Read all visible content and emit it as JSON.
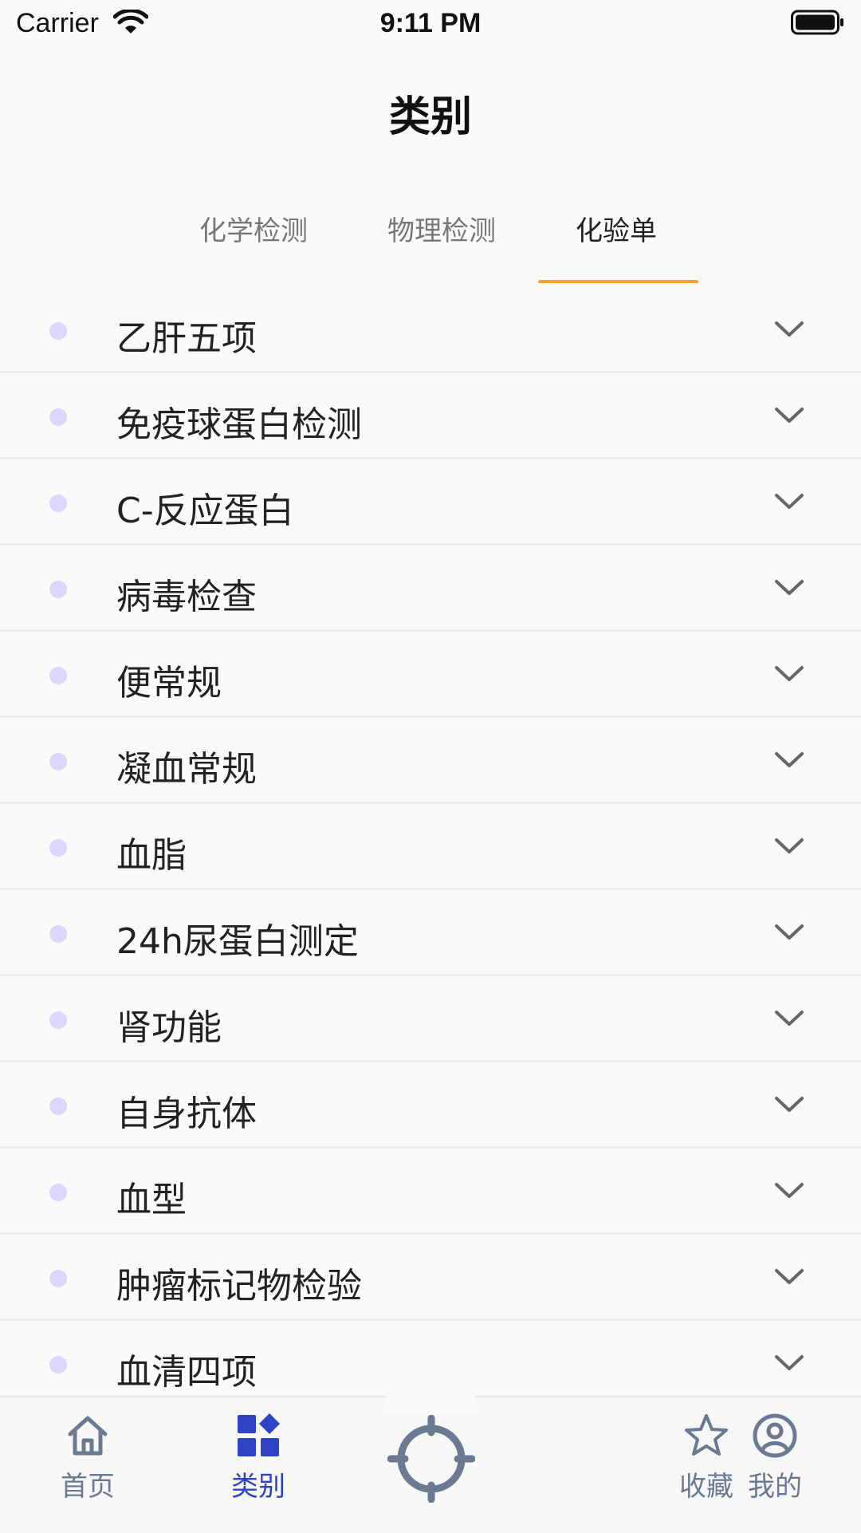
{
  "status_bar": {
    "carrier": "Carrier",
    "time": "9:11 PM"
  },
  "header": {
    "title": "类别"
  },
  "tabs": [
    {
      "label": "化学检测",
      "active": false
    },
    {
      "label": "物理检测",
      "active": false
    },
    {
      "label": "化验单",
      "active": true
    }
  ],
  "accent_color": "#f5a623",
  "active_nav_color": "#2d43c4",
  "list": {
    "items": [
      {
        "label": "乙肝五项"
      },
      {
        "label": "免疫球蛋白检测"
      },
      {
        "label": "C-反应蛋白"
      },
      {
        "label": "病毒检查"
      },
      {
        "label": "便常规"
      },
      {
        "label": "凝血常规"
      },
      {
        "label": "血脂"
      },
      {
        "label": "24h尿蛋白测定"
      },
      {
        "label": "肾功能"
      },
      {
        "label": "自身抗体"
      },
      {
        "label": "血型"
      },
      {
        "label": "肿瘤标记物检验"
      },
      {
        "label": "血清四项"
      }
    ]
  },
  "bottom_nav": {
    "items": [
      {
        "label": "首页",
        "icon": "home-icon",
        "active": false
      },
      {
        "label": "类别",
        "icon": "category-icon",
        "active": true
      },
      {
        "label": "",
        "icon": "crosshair-icon",
        "active": false
      },
      {
        "label": "收藏",
        "icon": "star-icon",
        "active": false
      },
      {
        "label": "我的",
        "icon": "profile-icon",
        "active": false
      }
    ]
  }
}
